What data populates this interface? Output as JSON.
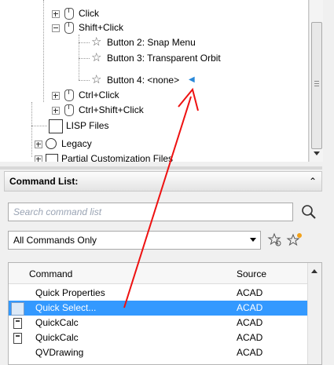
{
  "tree": {
    "items": [
      {
        "label": "Click"
      },
      {
        "label": "Shift+Click"
      },
      {
        "label": "Button 2: Snap Menu"
      },
      {
        "label": "Button 3: Transparent Orbit"
      },
      {
        "label": "Button 4: <none>"
      },
      {
        "label": "Ctrl+Click"
      },
      {
        "label": "Ctrl+Shift+Click"
      },
      {
        "label": "LISP Files"
      },
      {
        "label": "Legacy"
      },
      {
        "label": "Partial Customization Files"
      }
    ]
  },
  "command_list": {
    "title": "Command List:",
    "search_placeholder": "Search command list",
    "filter_value": "All Commands Only",
    "columns": {
      "command": "Command",
      "source": "Source"
    },
    "rows": [
      {
        "command": "Quick Properties",
        "source": "ACAD"
      },
      {
        "command": "Quick Select...",
        "source": "ACAD"
      },
      {
        "command": "QuickCalc",
        "source": "ACAD"
      },
      {
        "command": "QuickCalc",
        "source": "ACAD"
      },
      {
        "command": "QVDrawing",
        "source": "ACAD"
      }
    ]
  },
  "annotation_color": "#ee1111",
  "selection_color": "#3399ff"
}
